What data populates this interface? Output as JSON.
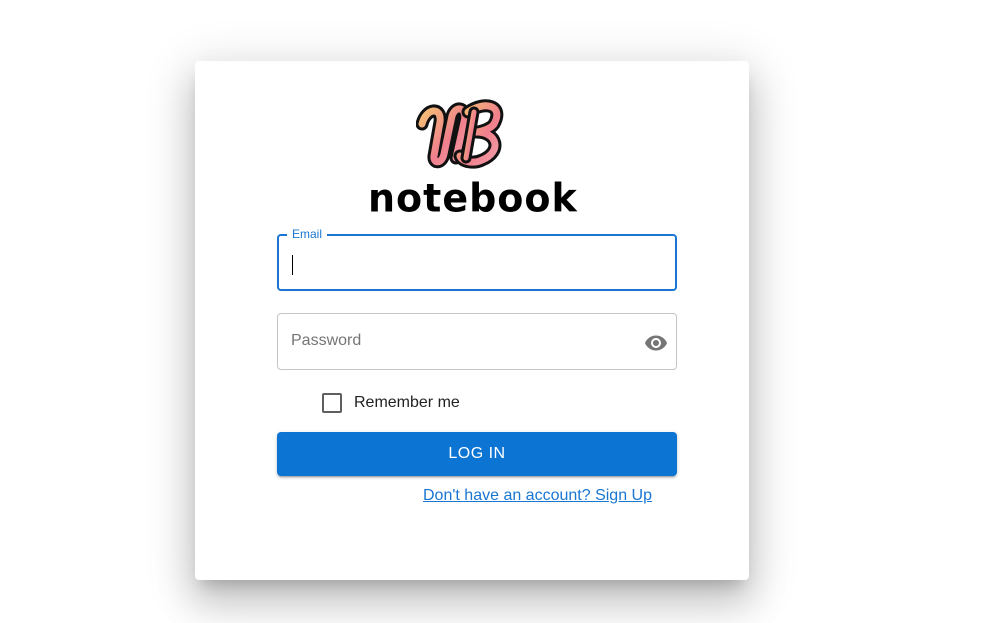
{
  "brand": {
    "badge_text": "NB",
    "word": "notebook",
    "badge_colors": [
      "#f6c174",
      "#ef7f8c",
      "#f29ea8"
    ]
  },
  "form": {
    "email": {
      "label": "Email",
      "value": "",
      "placeholder": ""
    },
    "password": {
      "placeholder": "Password",
      "value": "",
      "icon": "eye-icon"
    },
    "remember_label": "Remember me",
    "remember_checked": false,
    "login_label": "LOG IN",
    "signup_link": "Don't have an account? Sign Up"
  },
  "colors": {
    "accent": "#1976d2",
    "button": "#0c74d2"
  }
}
